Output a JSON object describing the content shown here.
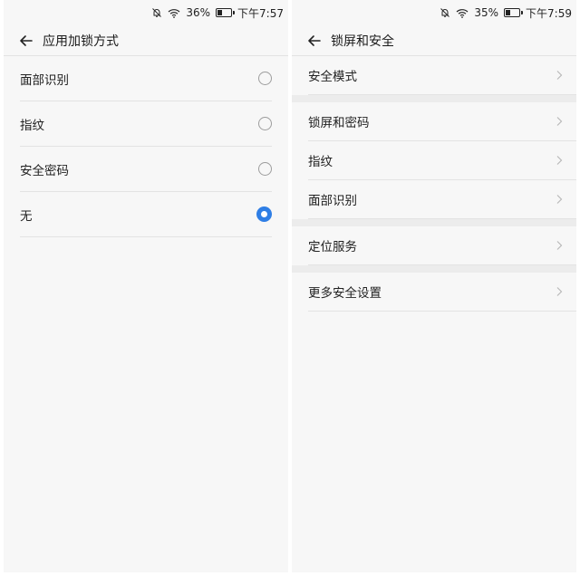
{
  "left": {
    "status": {
      "battery": "36%",
      "time": "下午7:57",
      "battery_level": 0.36
    },
    "title": "应用加锁方式",
    "options": [
      {
        "label": "面部识别",
        "selected": false
      },
      {
        "label": "指纹",
        "selected": false
      },
      {
        "label": "安全密码",
        "selected": false
      },
      {
        "label": "无",
        "selected": true
      }
    ]
  },
  "right": {
    "status": {
      "battery": "35%",
      "time": "下午7:59",
      "battery_level": 0.35
    },
    "title": "锁屏和安全",
    "groups": [
      [
        "安全模式"
      ],
      [
        "锁屏和密码",
        "指纹",
        "面部识别"
      ],
      [
        "定位服务"
      ],
      [
        "更多安全设置"
      ]
    ]
  },
  "colors": {
    "accent": "#2f7ee5"
  }
}
